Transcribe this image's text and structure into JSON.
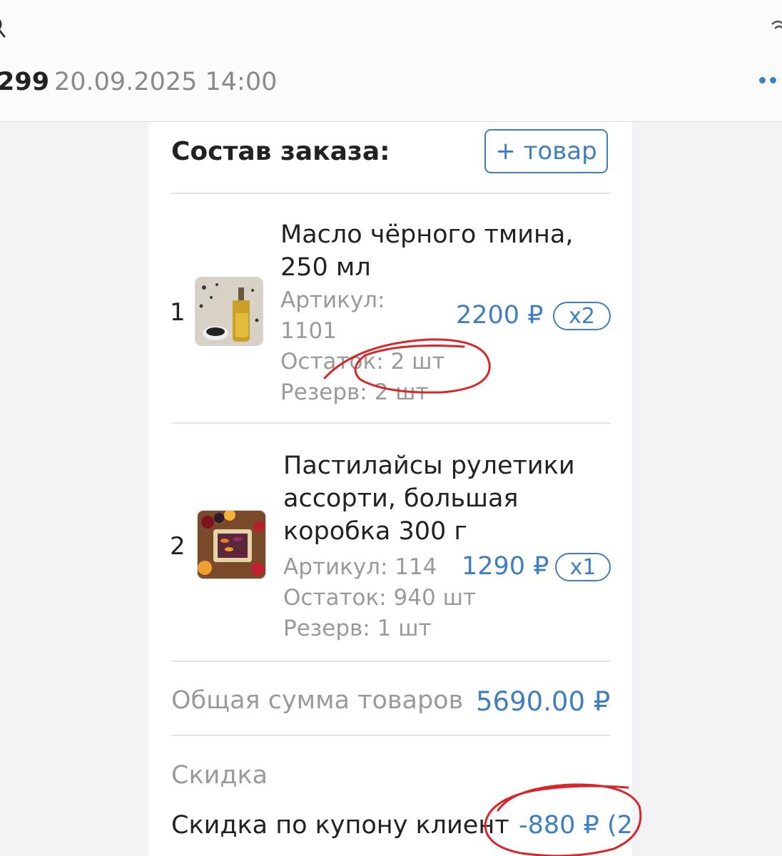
{
  "header": {
    "order_number": "299",
    "order_datetime": "20.09.2025 14:00"
  },
  "order": {
    "title": "Состав заказа:",
    "add_button_label": "+ товар",
    "items": [
      {
        "index": "1",
        "name_line1": "Масло чёрного тмина,",
        "name_line2": "250 мл",
        "sku_line1": "Артикул:",
        "sku_line2": "1101",
        "stock": "Остаток: 2 шт",
        "reserve": "Резерв: 2 шт",
        "price": "2200 ₽",
        "qty": "x2"
      },
      {
        "index": "2",
        "name_line1": "Пастилайсы рулетики",
        "name_line2": "ассорти, большая",
        "name_line3": "коробка 300 г",
        "sku": "Артикул: 114",
        "stock": "Остаток: 940 шт",
        "reserve": "Резерв: 1 шт",
        "price": "1290 ₽",
        "qty": "x1"
      }
    ],
    "total_label": "Общая сумма товаров",
    "total_value": "5690.00 ₽",
    "discount_title": "Скидка",
    "coupon_label": "Скидка по купону клиент",
    "coupon_value": "-880 ₽ (2"
  },
  "colors": {
    "accent": "#3f7fc1",
    "annotation": "#d9262b",
    "muted_text": "#9a9a9a"
  },
  "icons": [
    "search-icon",
    "wifi-icon",
    "more-dots-icon"
  ]
}
